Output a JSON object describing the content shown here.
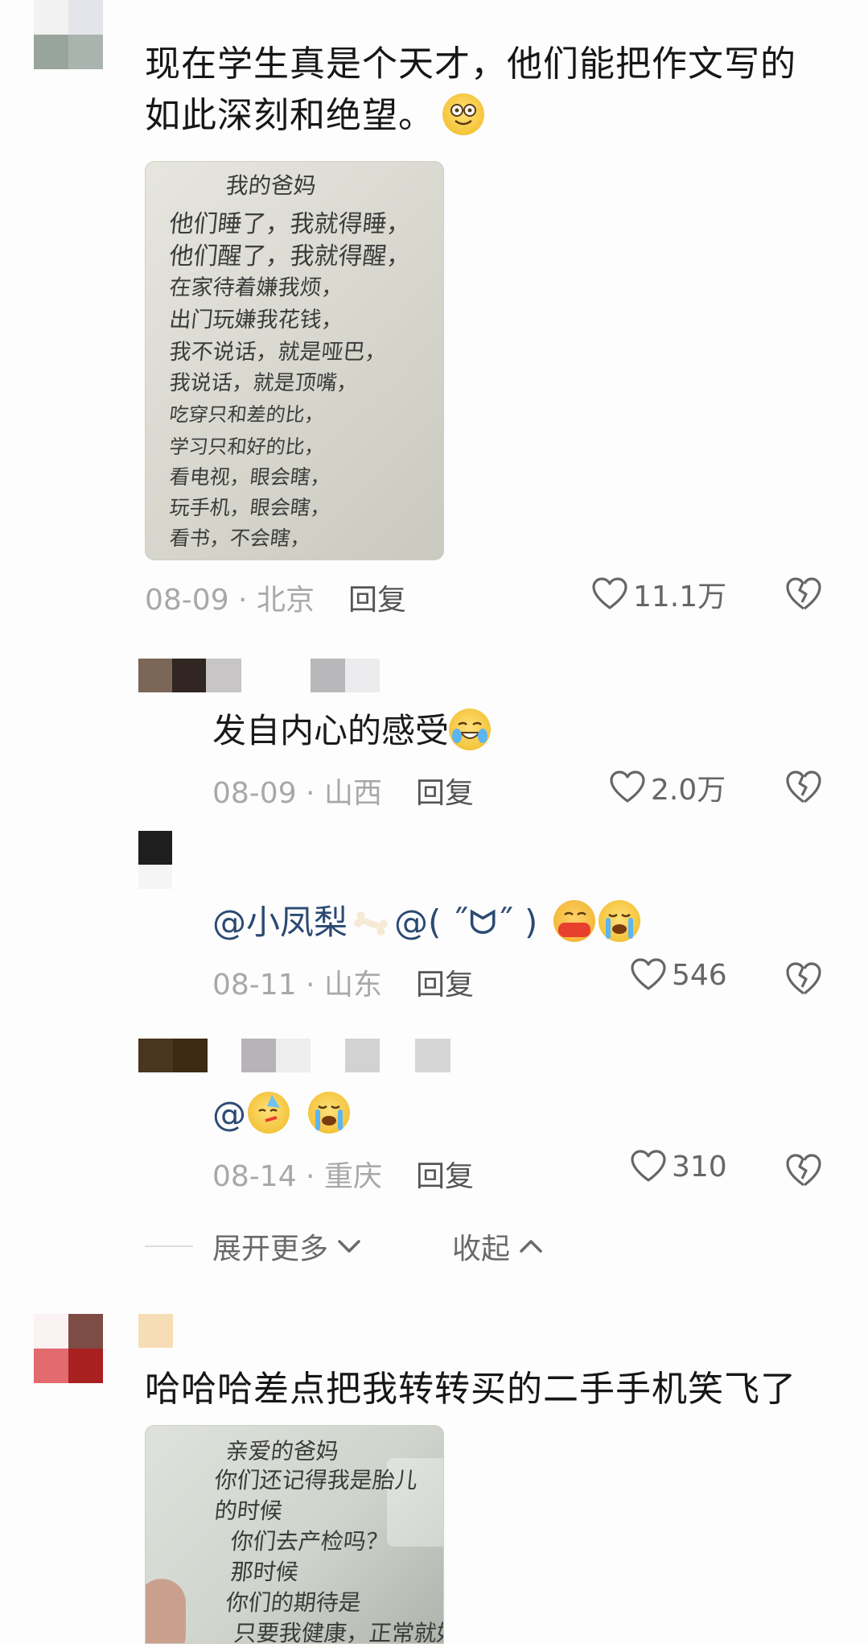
{
  "comments": [
    {
      "text": "现在学生真是个天才，他们能把作文写的如此深刻和绝望。",
      "image_lines": [
        "我的爸妈",
        "他们睡了，我就得睡，",
        "他们醒了，我就得醒，",
        "在家待着嫌我烦，",
        "出门玩嫌我花钱，",
        "我不说话，就是哑巴，",
        "我说话，就是顶嘴，",
        "吃穿只和差的比，",
        "学习只和好的比，",
        "看电视，眼会瞎，",
        "玩手机，眼会瞎，",
        "看书，不会瞎，"
      ],
      "date": "08-09",
      "location": "北京",
      "reply_label": "回复",
      "likes": "11.1万"
    },
    {
      "text": "哈哈哈差点把我转转买的二手手机笑飞了",
      "image_lines": [
        "亲爱的爸妈",
        "你们还记得我是胎儿",
        "的时候",
        "你们去产检吗？",
        "那时候",
        "你们的期待是",
        "只要我健康，正常就好"
      ]
    }
  ],
  "replies": [
    {
      "text": "发自内心的感受",
      "date": "08-09",
      "location": "山西",
      "reply_label": "回复",
      "likes": "2.0万"
    },
    {
      "mention1": "@小凤梨",
      "mention2": "@( ˝ᗢ˝ )",
      "date": "08-11",
      "location": "山东",
      "reply_label": "回复",
      "likes": "546"
    },
    {
      "mention1": "@",
      "date": "08-14",
      "location": "重庆",
      "reply_label": "回复",
      "likes": "310"
    }
  ],
  "controls": {
    "expand_more": "展开更多",
    "collapse": "收起"
  },
  "separator": " · ",
  "colors": {
    "mention": "#2b4a72",
    "meta": "#a8a8a8",
    "icon": "#666666"
  }
}
